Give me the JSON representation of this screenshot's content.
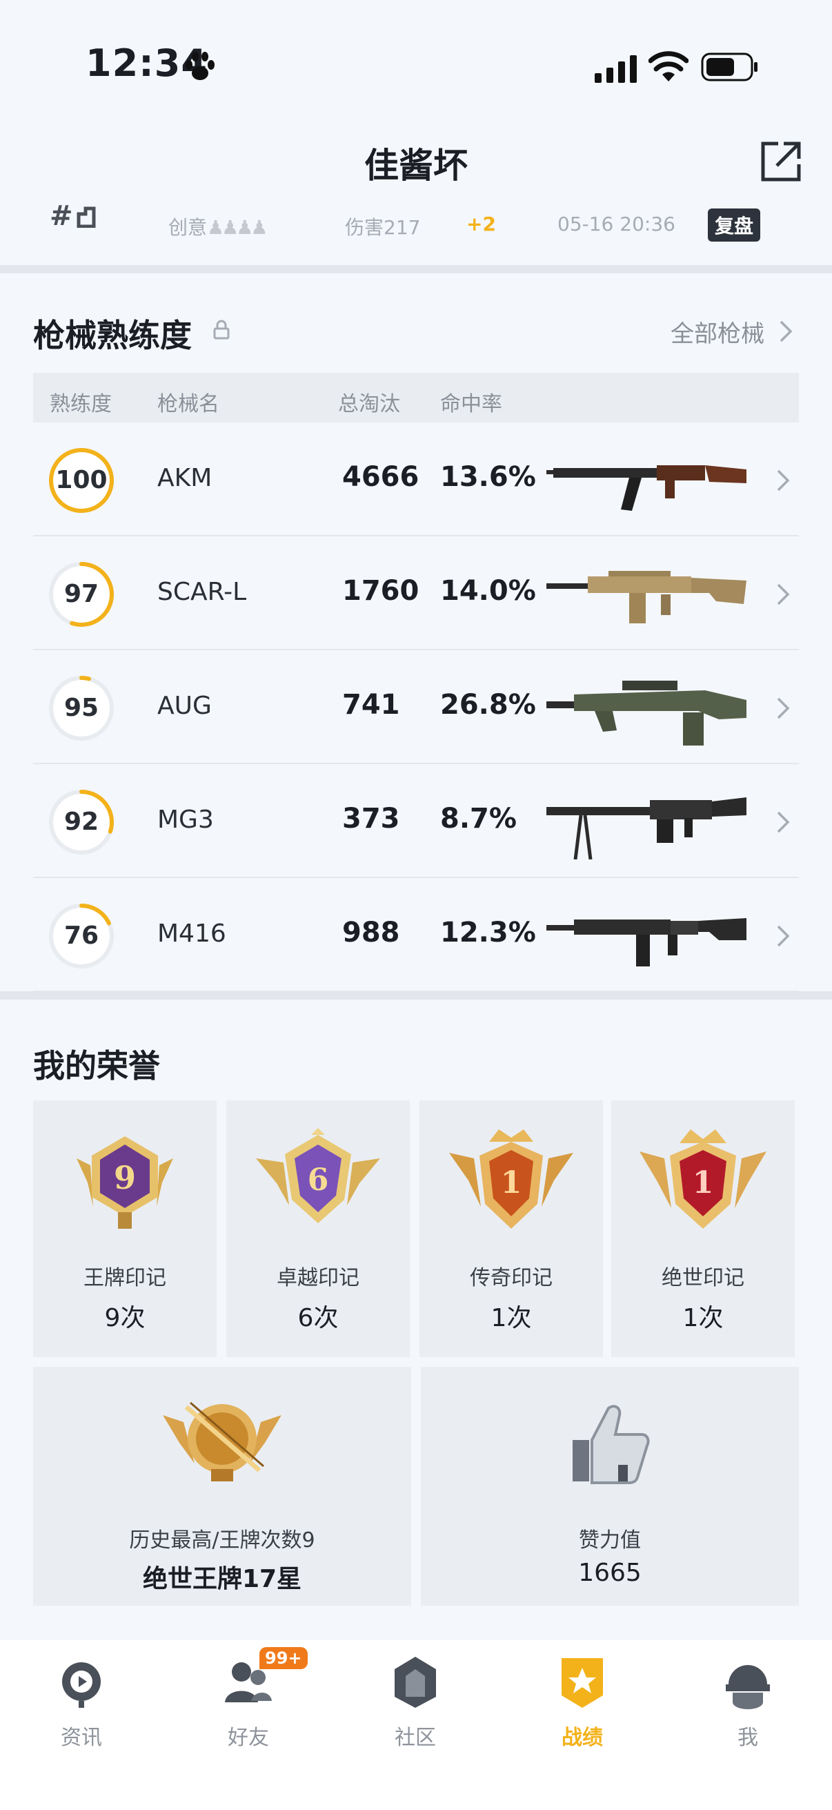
{
  "status_bar": {
    "time": "12:34"
  },
  "header": {
    "title": "佳酱坏"
  },
  "match": {
    "rank": "#",
    "mode": "创意",
    "damage": "伤害217",
    "delta": "+2",
    "time": "05-16 20:36",
    "replay_label": "复盘"
  },
  "weapons": {
    "title": "枪械熟练度",
    "all_label": "全部枪械",
    "columns": [
      "熟练度",
      "枪械名",
      "总淘汰",
      "命中率"
    ],
    "rows": [
      {
        "level": "100",
        "progress": 1.0,
        "name": "AKM",
        "kills": "4666",
        "accuracy": "13.6%"
      },
      {
        "level": "97",
        "progress": 0.55,
        "name": "SCAR-L",
        "kills": "1760",
        "accuracy": "14.0%"
      },
      {
        "level": "95",
        "progress": 0.04,
        "name": "AUG",
        "kills": "741",
        "accuracy": "26.8%"
      },
      {
        "level": "92",
        "progress": 0.3,
        "name": "MG3",
        "kills": "373",
        "accuracy": "8.7%"
      },
      {
        "level": "76",
        "progress": 0.18,
        "name": "M416",
        "kills": "988",
        "accuracy": "12.3%"
      }
    ]
  },
  "honors": {
    "title": "我的荣誉",
    "marks": [
      {
        "badge_number": "9",
        "label": "王牌印记",
        "count": "9次",
        "color": "#6a3b8c"
      },
      {
        "badge_number": "6",
        "label": "卓越印记",
        "count": "6次",
        "color": "#7a52b8"
      },
      {
        "badge_number": "1",
        "label": "传奇印记",
        "count": "1次",
        "color": "#c9531c"
      },
      {
        "badge_number": "1",
        "label": "绝世印记",
        "count": "1次",
        "color": "#b21a2a"
      }
    ],
    "best": {
      "label": "历史最高/王牌次数9",
      "value": "绝世王牌17星"
    },
    "likes": {
      "label": "赞力值",
      "value": "1665"
    }
  },
  "tabbar": {
    "friends_badge": "99+",
    "tabs": [
      {
        "label": "资讯",
        "icon": "news-icon"
      },
      {
        "label": "好友",
        "icon": "friends-icon"
      },
      {
        "label": "社区",
        "icon": "community-icon"
      },
      {
        "label": "战绩",
        "icon": "record-icon",
        "active": true
      },
      {
        "label": "我",
        "icon": "profile-icon"
      }
    ]
  },
  "colors": {
    "accent": "#f3b21a",
    "ring_track": "#e8ebef"
  }
}
